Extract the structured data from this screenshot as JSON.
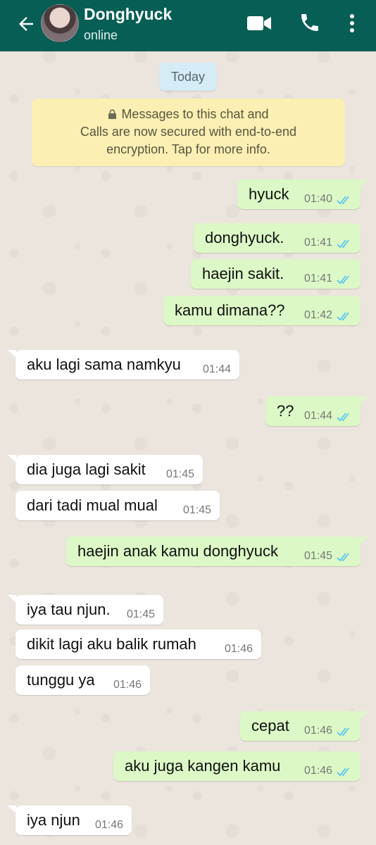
{
  "header": {
    "contact_name": "Donghyuck",
    "status": "online",
    "icons": [
      "back-arrow-icon",
      "video-call-icon",
      "phone-call-icon",
      "more-options-icon"
    ],
    "color": "#075e54"
  },
  "date_chip": "Today",
  "encryption_notice": {
    "line1": "Messages to this chat and",
    "line2": "Calls are now secured with end-to-end",
    "line3": "encryption. Tap for more info."
  },
  "colors": {
    "outgoing_bubble": "#dcf8c6",
    "incoming_bubble": "#ffffff",
    "read_ticks": "#4fc3f7"
  },
  "messages": [
    {
      "direction": "out",
      "text": "hyuck",
      "time": "01:40",
      "status": "read"
    },
    {
      "direction": "out",
      "text": "donghyuck.",
      "time": "01:41",
      "status": "read"
    },
    {
      "direction": "out",
      "text": "haejin sakit.",
      "time": "01:41",
      "status": "read"
    },
    {
      "direction": "out",
      "text": "kamu dimana??",
      "time": "01:42",
      "status": "read"
    },
    {
      "direction": "in",
      "text": "aku lagi sama namkyu",
      "time": "01:44"
    },
    {
      "direction": "out",
      "text": "??",
      "time": "01:44",
      "status": "read"
    },
    {
      "direction": "in",
      "text": "dia juga lagi sakit",
      "time": "01:45"
    },
    {
      "direction": "in",
      "text": "dari tadi mual mual",
      "time": "01:45"
    },
    {
      "direction": "out",
      "text": "haejin anak kamu donghyuck",
      "time": "01:45",
      "status": "read"
    },
    {
      "direction": "in",
      "text": "iya tau njun.",
      "time": "01:45"
    },
    {
      "direction": "in",
      "text": "dikit lagi aku balik rumah",
      "time": "01:46"
    },
    {
      "direction": "in",
      "text": "tunggu ya",
      "time": "01:46"
    },
    {
      "direction": "out",
      "text": "cepat",
      "time": "01:46",
      "status": "read"
    },
    {
      "direction": "out",
      "text": "aku juga kangen kamu",
      "time": "01:46",
      "status": "read"
    },
    {
      "direction": "in",
      "text": "iya njun",
      "time": "01:46"
    }
  ]
}
